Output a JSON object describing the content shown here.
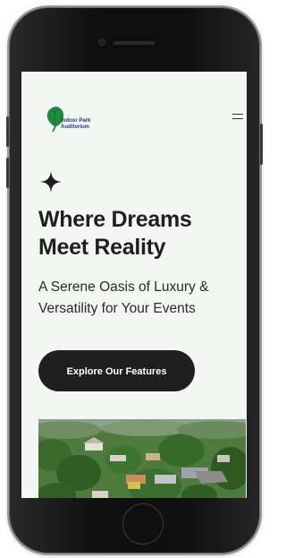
{
  "brand": {
    "name_line1": "Indoor Park",
    "name_line2": "Auditorium",
    "logo_icon": "green-leaf-icon",
    "text_color": "#1b3a8a",
    "leaf_color": "#1f8a3c"
  },
  "header": {
    "menu_icon": "hamburger-menu-icon"
  },
  "hero": {
    "sparkle_icon": "four-point-star-icon",
    "title_line1": "Where Dreams",
    "title_line2": "Meet Reality",
    "subtitle_line1": "A Serene Oasis of Luxury &",
    "subtitle_line2": "Versatility for Your Events",
    "cta_label": "Explore Our Features",
    "cta_color": "#1f1f1f"
  },
  "image": {
    "alt": "aerial view of houses among trees"
  },
  "colors": {
    "screen_background": "#f4f6f4",
    "text": "#1f1f1f"
  }
}
